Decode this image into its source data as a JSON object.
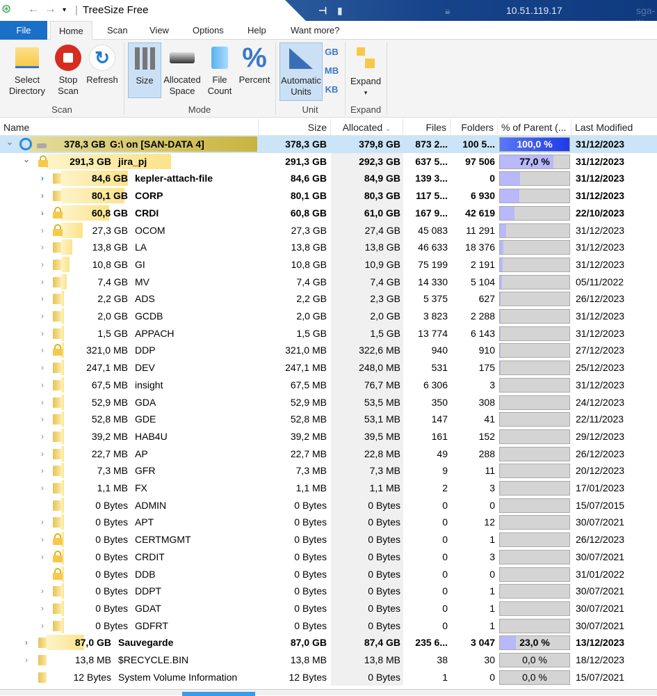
{
  "window": {
    "title": "TreeSize Free",
    "remote_ip": "10.51.119.17",
    "remote_host": "sga-w"
  },
  "tabs": [
    "File",
    "Home",
    "Scan",
    "View",
    "Options",
    "Help",
    "Want more?"
  ],
  "ribbon": {
    "scan": {
      "group": "Scan",
      "select_directory": "Select Directory",
      "stop_scan": "Stop Scan",
      "refresh": "Refresh"
    },
    "mode": {
      "group": "Mode",
      "size": "Size",
      "allocated_space": "Allocated Space",
      "file_count": "File Count",
      "percent": "Percent",
      "selected": "Size"
    },
    "unit": {
      "group": "Unit",
      "automatic_units": "Automatic Units",
      "gb": "GB",
      "mb": "MB",
      "kb": "KB"
    },
    "expand": {
      "group": "Expand",
      "expand": "Expand"
    }
  },
  "columns": {
    "name": "Name",
    "size": "Size",
    "allocated": "Allocated",
    "files": "Files",
    "folders": "Folders",
    "percent": "% of Parent (...",
    "last_modified": "Last Modified",
    "sort_column": "Allocated"
  },
  "colors": {
    "root_bar": "#c8b440",
    "pct_fill": "#b8b8fa",
    "pct_root": "#2e4bf0",
    "selection": "#cce4f7"
  },
  "rows": [
    {
      "level": 0,
      "exp": "open",
      "icon": "drive",
      "label_size": "378,3 GB",
      "name": "G:\\  on  [SAN-DATA 4]",
      "size": "378,3 GB",
      "alloc": "379,8 GB",
      "files": "873 2...",
      "folders": "100 5...",
      "pct": 100.0,
      "pct_text": "100,0 %",
      "date": "31/12/2023",
      "bold": true
    },
    {
      "level": 1,
      "exp": "open",
      "icon": "lock",
      "label_size": "291,3 GB",
      "name": "jira_pj",
      "size": "291,3 GB",
      "alloc": "292,3 GB",
      "files": "637 5...",
      "folders": "97 506",
      "pct": 77.0,
      "pct_text": "77,0 %",
      "date": "31/12/2023",
      "bold": true
    },
    {
      "level": 2,
      "exp": "closed",
      "icon": "folder",
      "label_size": "84,6 GB",
      "name": "kepler-attach-file",
      "size": "84,6 GB",
      "alloc": "84,9 GB",
      "files": "139 3...",
      "folders": "0",
      "pct": 29.0,
      "date": "31/12/2023",
      "bold": true
    },
    {
      "level": 2,
      "exp": "closed",
      "icon": "folder",
      "label_size": "80,1 GB",
      "name": "CORP",
      "size": "80,1 GB",
      "alloc": "80,3 GB",
      "files": "117 5...",
      "folders": "6 930",
      "pct": 27.5,
      "date": "31/12/2023",
      "bold": true
    },
    {
      "level": 2,
      "exp": "closed",
      "icon": "lock",
      "label_size": "60,8 GB",
      "name": "CRDI",
      "size": "60,8 GB",
      "alloc": "61,0 GB",
      "files": "167 9...",
      "folders": "42 619",
      "pct": 20.9,
      "date": "22/10/2023",
      "bold": true
    },
    {
      "level": 2,
      "exp": "closed",
      "icon": "lock",
      "label_size": "27,3 GB",
      "name": "OCOM",
      "size": "27,3 GB",
      "alloc": "27,4 GB",
      "files": "45 083",
      "folders": "11 291",
      "pct": 9.4,
      "date": "31/12/2023"
    },
    {
      "level": 2,
      "exp": "closed",
      "icon": "folder",
      "label_size": "13,8 GB",
      "name": "LA",
      "size": "13,8 GB",
      "alloc": "13,8 GB",
      "files": "46 633",
      "folders": "18 376",
      "pct": 4.7,
      "date": "31/12/2023"
    },
    {
      "level": 2,
      "exp": "closed",
      "icon": "folder",
      "label_size": "10,8 GB",
      "name": "GI",
      "size": "10,8 GB",
      "alloc": "10,9 GB",
      "files": "75 199",
      "folders": "2 191",
      "pct": 3.7,
      "date": "31/12/2023"
    },
    {
      "level": 2,
      "exp": "closed",
      "icon": "folder",
      "label_size": "7,4 GB",
      "name": "MV",
      "size": "7,4 GB",
      "alloc": "7,4 GB",
      "files": "14 330",
      "folders": "5 104",
      "pct": 2.5,
      "date": "05/11/2022"
    },
    {
      "level": 2,
      "exp": "closed",
      "icon": "folder",
      "label_size": "2,2 GB",
      "name": "ADS",
      "size": "2,2 GB",
      "alloc": "2,3 GB",
      "files": "5 375",
      "folders": "627",
      "pct": 0.8,
      "date": "26/12/2023"
    },
    {
      "level": 2,
      "exp": "closed",
      "icon": "folder",
      "label_size": "2,0 GB",
      "name": "GCDB",
      "size": "2,0 GB",
      "alloc": "2,0 GB",
      "files": "3 823",
      "folders": "2 288",
      "pct": 0.7,
      "date": "31/12/2023"
    },
    {
      "level": 2,
      "exp": "closed",
      "icon": "folder",
      "label_size": "1,5 GB",
      "name": "APPACH",
      "size": "1,5 GB",
      "alloc": "1,5 GB",
      "files": "13 774",
      "folders": "6 143",
      "pct": 0.5,
      "date": "31/12/2023"
    },
    {
      "level": 2,
      "exp": "closed",
      "icon": "lock",
      "label_size": "321,0 MB",
      "name": "DDP",
      "size": "321,0 MB",
      "alloc": "322,6 MB",
      "files": "940",
      "folders": "910",
      "pct": 0.1,
      "date": "27/12/2023"
    },
    {
      "level": 2,
      "exp": "closed",
      "icon": "folder",
      "label_size": "247,1 MB",
      "name": "DEV",
      "size": "247,1 MB",
      "alloc": "248,0 MB",
      "files": "531",
      "folders": "175",
      "pct": 0.1,
      "date": "25/12/2023"
    },
    {
      "level": 2,
      "exp": "closed",
      "icon": "folder",
      "label_size": "67,5 MB",
      "name": "insight",
      "size": "67,5 MB",
      "alloc": "76,7 MB",
      "files": "6 306",
      "folders": "3",
      "pct": 0,
      "date": "31/12/2023"
    },
    {
      "level": 2,
      "exp": "closed",
      "icon": "folder",
      "label_size": "52,9 MB",
      "name": "GDA",
      "size": "52,9 MB",
      "alloc": "53,5 MB",
      "files": "350",
      "folders": "308",
      "pct": 0,
      "date": "24/12/2023"
    },
    {
      "level": 2,
      "exp": "closed",
      "icon": "folder",
      "label_size": "52,8 MB",
      "name": "GDE",
      "size": "52,8 MB",
      "alloc": "53,1 MB",
      "files": "147",
      "folders": "41",
      "pct": 0,
      "date": "22/11/2023"
    },
    {
      "level": 2,
      "exp": "closed",
      "icon": "folder",
      "label_size": "39,2 MB",
      "name": "HAB4U",
      "size": "39,2 MB",
      "alloc": "39,5 MB",
      "files": "161",
      "folders": "152",
      "pct": 0,
      "date": "29/12/2023"
    },
    {
      "level": 2,
      "exp": "closed",
      "icon": "folder",
      "label_size": "22,7 MB",
      "name": "AP",
      "size": "22,7 MB",
      "alloc": "22,8 MB",
      "files": "49",
      "folders": "288",
      "pct": 0,
      "date": "26/12/2023"
    },
    {
      "level": 2,
      "exp": "closed",
      "icon": "folder",
      "label_size": "7,3 MB",
      "name": "GFR",
      "size": "7,3 MB",
      "alloc": "7,3 MB",
      "files": "9",
      "folders": "11",
      "pct": 0,
      "date": "20/12/2023"
    },
    {
      "level": 2,
      "exp": "closed",
      "icon": "folder",
      "label_size": "1,1 MB",
      "name": "FX",
      "size": "1,1 MB",
      "alloc": "1,1 MB",
      "files": "2",
      "folders": "3",
      "pct": 0,
      "date": "17/01/2023"
    },
    {
      "level": 2,
      "exp": "none",
      "icon": "folder",
      "label_size": "0 Bytes",
      "name": "ADMIN",
      "size": "0 Bytes",
      "alloc": "0 Bytes",
      "files": "0",
      "folders": "0",
      "pct": 0,
      "date": "15/07/2015"
    },
    {
      "level": 2,
      "exp": "closed",
      "icon": "folder",
      "label_size": "0 Bytes",
      "name": "APT",
      "size": "0 Bytes",
      "alloc": "0 Bytes",
      "files": "0",
      "folders": "12",
      "pct": 0,
      "date": "30/07/2021"
    },
    {
      "level": 2,
      "exp": "closed",
      "icon": "lock",
      "label_size": "0 Bytes",
      "name": "CERTMGMT",
      "size": "0 Bytes",
      "alloc": "0 Bytes",
      "files": "0",
      "folders": "1",
      "pct": 0,
      "date": "26/12/2023"
    },
    {
      "level": 2,
      "exp": "closed",
      "icon": "lock",
      "label_size": "0 Bytes",
      "name": "CRDIT",
      "size": "0 Bytes",
      "alloc": "0 Bytes",
      "files": "0",
      "folders": "3",
      "pct": 0,
      "date": "30/07/2021"
    },
    {
      "level": 2,
      "exp": "none",
      "icon": "lock",
      "label_size": "0 Bytes",
      "name": "DDB",
      "size": "0 Bytes",
      "alloc": "0 Bytes",
      "files": "0",
      "folders": "0",
      "pct": 0,
      "date": "31/01/2022"
    },
    {
      "level": 2,
      "exp": "closed",
      "icon": "folder",
      "label_size": "0 Bytes",
      "name": "DDPT",
      "size": "0 Bytes",
      "alloc": "0 Bytes",
      "files": "0",
      "folders": "1",
      "pct": 0,
      "date": "30/07/2021"
    },
    {
      "level": 2,
      "exp": "closed",
      "icon": "folder",
      "label_size": "0 Bytes",
      "name": "GDAT",
      "size": "0 Bytes",
      "alloc": "0 Bytes",
      "files": "0",
      "folders": "1",
      "pct": 0,
      "date": "30/07/2021"
    },
    {
      "level": 2,
      "exp": "closed",
      "icon": "folder",
      "label_size": "0 Bytes",
      "name": "GDFRT",
      "size": "0 Bytes",
      "alloc": "0 Bytes",
      "files": "0",
      "folders": "1",
      "pct": 0,
      "date": "30/07/2021"
    },
    {
      "level": 1,
      "exp": "closed",
      "icon": "folder",
      "label_size": "87,0 GB",
      "name": "Sauvegarde",
      "size": "87,0 GB",
      "alloc": "87,4 GB",
      "files": "235 6...",
      "folders": "3 047",
      "pct": 23.0,
      "pct_text": "23,0 %",
      "date": "13/12/2023",
      "bold": true
    },
    {
      "level": 1,
      "exp": "closed",
      "icon": "folder",
      "label_size": "13,8 MB",
      "name": "$RECYCLE.BIN",
      "size": "13,8 MB",
      "alloc": "13,8 MB",
      "files": "38",
      "folders": "30",
      "pct": 0,
      "pct_text": "0,0 %",
      "date": "18/12/2023"
    },
    {
      "level": 1,
      "exp": "none",
      "icon": "folder",
      "label_size": "12 Bytes",
      "name": "System Volume Information",
      "size": "12 Bytes",
      "alloc": "0 Bytes",
      "files": "1",
      "folders": "0",
      "pct": 0,
      "pct_text": "0,0 %",
      "date": "15/07/2021"
    }
  ]
}
